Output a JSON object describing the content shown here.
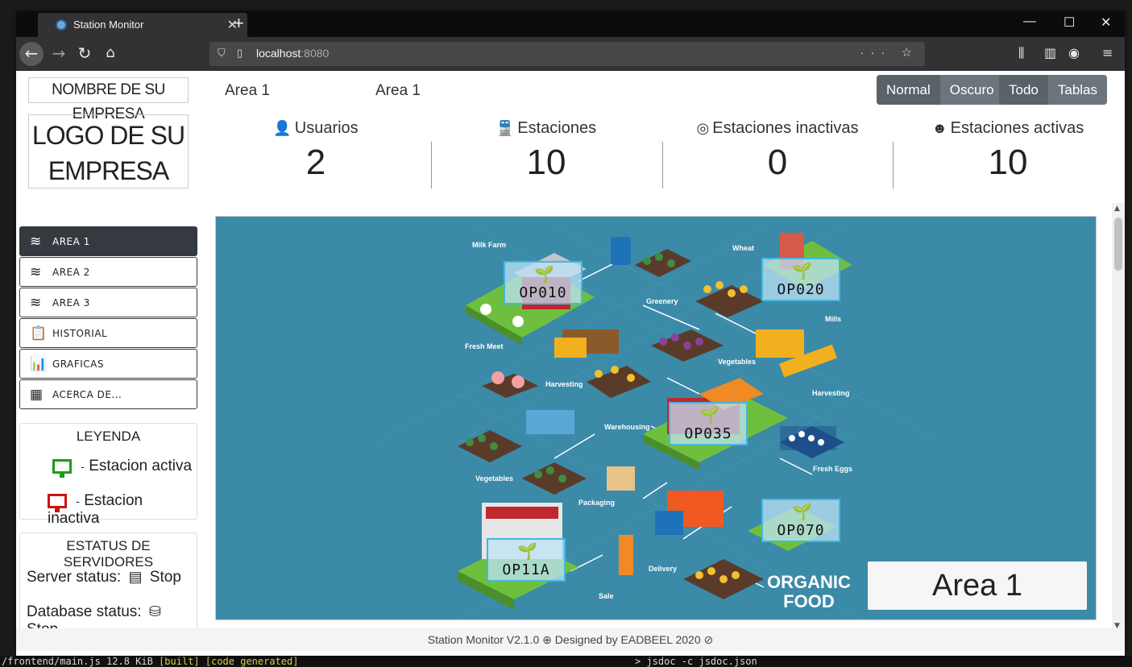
{
  "browser": {
    "tab_title": "Station Monitor",
    "url_host": "localhost",
    "url_port": ":8080"
  },
  "terminal": {
    "bottom_left": "/frontend/main.js 12.8 KiB",
    "bottom_built": "[built] [code generated]",
    "bottom_right": "> jsdoc -c jsdoc.json"
  },
  "header": {
    "company_name": "NOMBRE DE SU EMPRESA",
    "nav_links": [
      "Area 1",
      "Area 1"
    ],
    "theme_buttons": [
      "Normal",
      "Oscuro"
    ],
    "view_buttons": [
      "Todo",
      "Tablas"
    ],
    "logo_text": "LOGO DE SU EMPRESA"
  },
  "stats": [
    {
      "label": "Usuarios",
      "value": "2",
      "icon": "user-icon"
    },
    {
      "label": "Estaciones",
      "value": "10",
      "icon": "train-icon"
    },
    {
      "label": "Estaciones inactivas",
      "value": "0",
      "icon": "eye-slash-icon"
    },
    {
      "label": "Estaciones activas",
      "value": "10",
      "icon": "smile-icon"
    }
  ],
  "sidebar": {
    "items": [
      {
        "label": "AREA 1",
        "icon": "layers-icon",
        "active": true
      },
      {
        "label": "AREA 2",
        "icon": "layers-icon",
        "active": false
      },
      {
        "label": "AREA 3",
        "icon": "layers-icon",
        "active": false
      },
      {
        "label": "HISTORIAL",
        "icon": "clipboard-icon",
        "active": false
      },
      {
        "label": "GRAFICAS",
        "icon": "bar-chart-icon",
        "active": false
      },
      {
        "label": "ACERCA DE...",
        "icon": "table-icon",
        "active": false
      }
    ]
  },
  "legend": {
    "title": "LEYENDA",
    "active_label": "Estacion activa",
    "inactive_label": "Estacion inactiva",
    "dash": "-",
    "active_color": "#1a9c1a",
    "inactive_color": "#cc1111"
  },
  "servers": {
    "title": "ESTATUS DE SERVIDORES",
    "server_label": "Server status:",
    "server_value": "Stop",
    "db_label": "Database status:",
    "db_value": "Stop"
  },
  "map": {
    "area_title": "Area 1",
    "organic_line1": "ORGANIC",
    "organic_line2": "FOOD",
    "stations": [
      "OP010",
      "OP020",
      "OP035",
      "OP070",
      "OP11A"
    ],
    "labels": [
      "Milk Farm",
      "Wheat",
      "Greenery",
      "Mills",
      "Fresh Meet",
      "Vegetables",
      "Harvesting",
      "Harvesting",
      "Warehousing",
      "Fresh Eggs",
      "Vegetables",
      "Packaging",
      "Delivery",
      "Sale"
    ]
  },
  "footer": {
    "text": "Station Monitor V2.1.0",
    "designed": "Designed by EADBEEL 2020"
  }
}
